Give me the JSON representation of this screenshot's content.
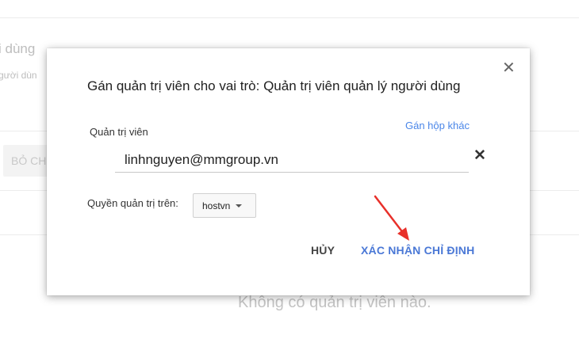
{
  "background": {
    "header_fragment": "i dùng",
    "subheader_fragment": "gười dùn",
    "button_fragment": "BỎ CH",
    "empty_message": "Không có quản trị viên nào."
  },
  "dialog": {
    "title": "Gán quản trị viên cho vai trò: Quản trị viên quản lý người dùng",
    "close_icon": "close-icon",
    "admin_label": "Quản trị viên",
    "other_assign_link": "Gán hộp khác",
    "email_value": "linhnguyen@mmgroup.vn",
    "scope_label": "Quyền quản trị trên:",
    "org_unit_value": "hostvn",
    "cancel_label": "HỦY",
    "confirm_label": "XÁC NHẬN CHỈ ĐỊNH"
  },
  "colors": {
    "accent": "#4a78d6",
    "link": "#4a86e8",
    "annotation_arrow": "#e8302a"
  }
}
